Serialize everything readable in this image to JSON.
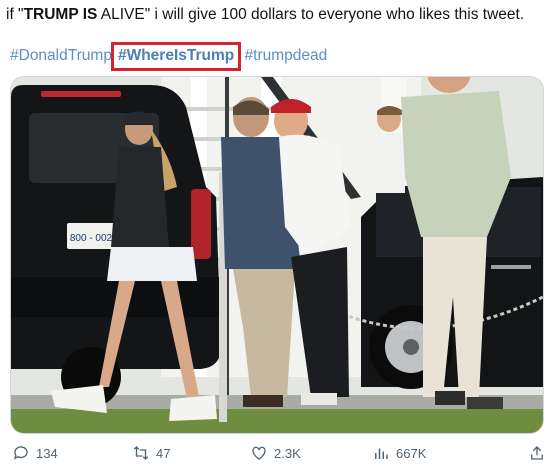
{
  "tweet": {
    "text_prefix": "if \"",
    "text_bold": "TRUMP IS",
    "text_suffix": " ALIVE\" i will give 100 dollars to everyone who likes this tweet.",
    "hashtags": [
      "#DonaldTrump",
      "#WhereIsTrump",
      "#trumpdead"
    ],
    "highlighted_hashtag_index": 1
  },
  "media": {
    "license_plate": "800 - 002"
  },
  "actions": {
    "replies": "134",
    "reposts": "47",
    "likes": "2.3K",
    "views": "667K"
  },
  "colors": {
    "hashtag": "#5b8fc7",
    "highlight_box": "#d6242c",
    "action_icons": "#536471"
  },
  "icons": [
    "reply-icon",
    "repost-icon",
    "like-icon",
    "views-icon",
    "share-icon"
  ]
}
